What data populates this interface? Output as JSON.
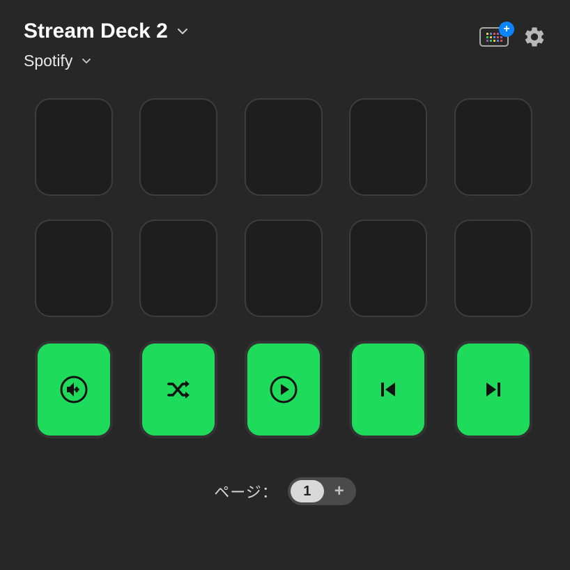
{
  "header": {
    "device_name": "Stream Deck 2",
    "profile_name": "Spotify"
  },
  "colors": {
    "spotify_green": "#1EDB5B",
    "badge_blue": "#0a84ff"
  },
  "keys": [
    {
      "row": 0,
      "col": 0,
      "empty": true
    },
    {
      "row": 0,
      "col": 1,
      "empty": true
    },
    {
      "row": 0,
      "col": 2,
      "empty": true
    },
    {
      "row": 0,
      "col": 3,
      "empty": true
    },
    {
      "row": 0,
      "col": 4,
      "empty": true
    },
    {
      "row": 1,
      "col": 0,
      "empty": true
    },
    {
      "row": 1,
      "col": 1,
      "empty": true
    },
    {
      "row": 1,
      "col": 2,
      "empty": true
    },
    {
      "row": 1,
      "col": 3,
      "empty": true
    },
    {
      "row": 1,
      "col": 4,
      "empty": true
    },
    {
      "row": 2,
      "col": 0,
      "empty": false,
      "icon": "volume-up-icon"
    },
    {
      "row": 2,
      "col": 1,
      "empty": false,
      "icon": "shuffle-icon"
    },
    {
      "row": 2,
      "col": 2,
      "empty": false,
      "icon": "play-icon"
    },
    {
      "row": 2,
      "col": 3,
      "empty": false,
      "icon": "previous-track-icon"
    },
    {
      "row": 2,
      "col": 4,
      "empty": false,
      "icon": "next-track-icon"
    }
  ],
  "pager": {
    "label": "ページ：",
    "current": "1",
    "add_label": "+"
  }
}
